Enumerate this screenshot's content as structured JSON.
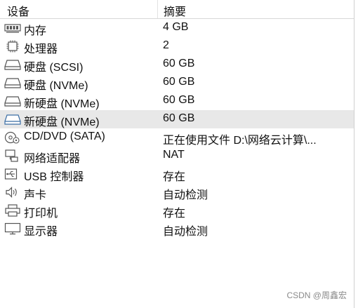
{
  "header": {
    "device_col": "设备",
    "summary_col": "摘要"
  },
  "devices": [
    {
      "icon": "memory-icon",
      "name": "内存",
      "summary": "4 GB"
    },
    {
      "icon": "processor-icon",
      "name": "处理器",
      "summary": "2"
    },
    {
      "icon": "hard-disk-icon",
      "name": "硬盘 (SCSI)",
      "summary": "60 GB"
    },
    {
      "icon": "hard-disk-icon",
      "name": "硬盘 (NVMe)",
      "summary": "60 GB"
    },
    {
      "icon": "hard-disk-icon",
      "name": "新硬盘 (NVMe)",
      "summary": "60 GB"
    },
    {
      "icon": "hard-disk-icon",
      "name": "新硬盘 (NVMe)",
      "summary": "60 GB",
      "selected": true
    },
    {
      "icon": "cd-dvd-icon",
      "name": "CD/DVD (SATA)",
      "summary": "正在使用文件 D:\\网络云计算\\..."
    },
    {
      "icon": "network-adapter-icon",
      "name": "网络适配器",
      "summary": "NAT"
    },
    {
      "icon": "usb-icon",
      "name": "USB 控制器",
      "summary": "存在"
    },
    {
      "icon": "sound-card-icon",
      "name": "声卡",
      "summary": "自动检测"
    },
    {
      "icon": "printer-icon",
      "name": "打印机",
      "summary": "存在"
    },
    {
      "icon": "display-icon",
      "name": "显示器",
      "summary": "自动检测"
    }
  ],
  "watermark": "CSDN @周鑫宏"
}
